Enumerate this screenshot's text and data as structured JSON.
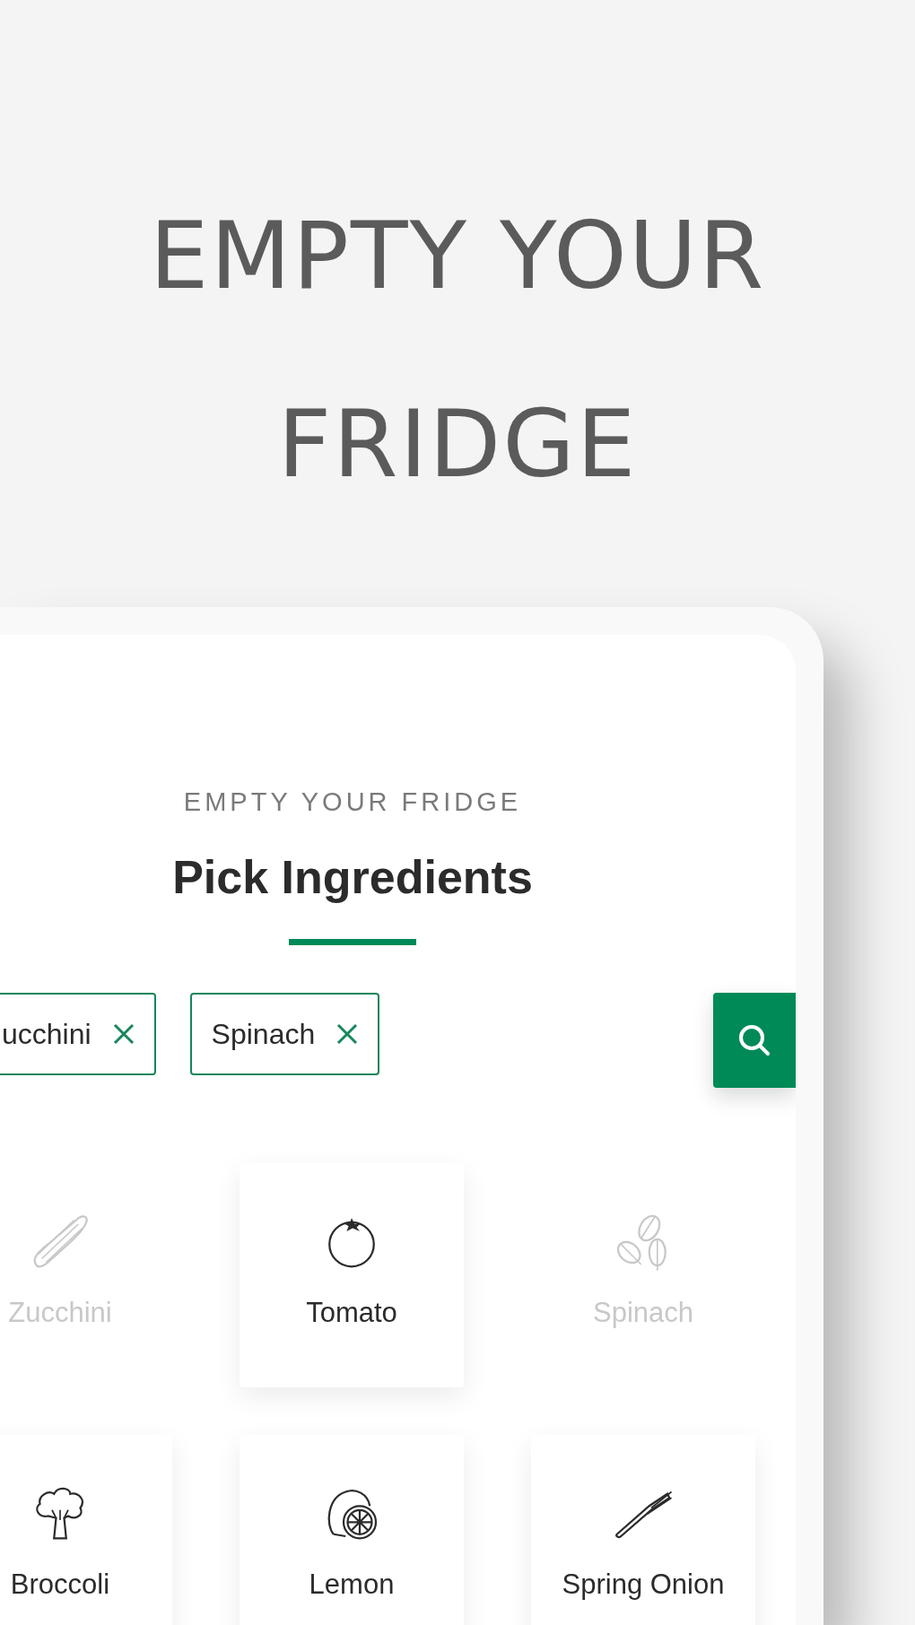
{
  "headline": [
    "EMPTY YOUR",
    "FRIDGE"
  ],
  "screen": {
    "eyebrow": "EMPTY YOUR FRIDGE",
    "title": "Pick Ingredients",
    "chips": [
      {
        "label": "ucchini"
      },
      {
        "label": "Spinach"
      }
    ],
    "ingredients": [
      {
        "name": "Zucchini",
        "kind": "zucchini",
        "selected": true
      },
      {
        "name": "Tomato",
        "kind": "tomato",
        "selected": false
      },
      {
        "name": "Spinach",
        "kind": "spinach",
        "selected": true
      },
      {
        "name": "Broccoli",
        "kind": "broccoli",
        "selected": false
      },
      {
        "name": "Lemon",
        "kind": "lemon",
        "selected": false
      },
      {
        "name": "Spring Onion",
        "kind": "onion",
        "selected": false
      }
    ]
  }
}
